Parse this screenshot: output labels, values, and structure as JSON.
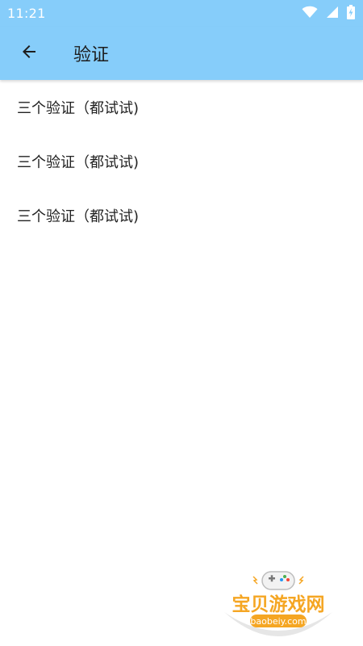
{
  "status_bar": {
    "time": "11:21",
    "icons": [
      "wifi-icon",
      "cellular-signal-icon",
      "battery-charging-icon"
    ]
  },
  "app_bar": {
    "back_icon": "arrow-left-icon",
    "title": "验证"
  },
  "list": {
    "items": [
      {
        "label": "三个验证（都试试)"
      },
      {
        "label": "三个验证（都试试)"
      },
      {
        "label": "三个验证（都试试)"
      }
    ]
  },
  "watermark": {
    "brand": "宝贝游戏网",
    "domain": "baobeiy.com",
    "icon": "gamepad-icon"
  },
  "colors": {
    "app_bar": "#86cdfa",
    "watermark_text": "#f5a623"
  }
}
